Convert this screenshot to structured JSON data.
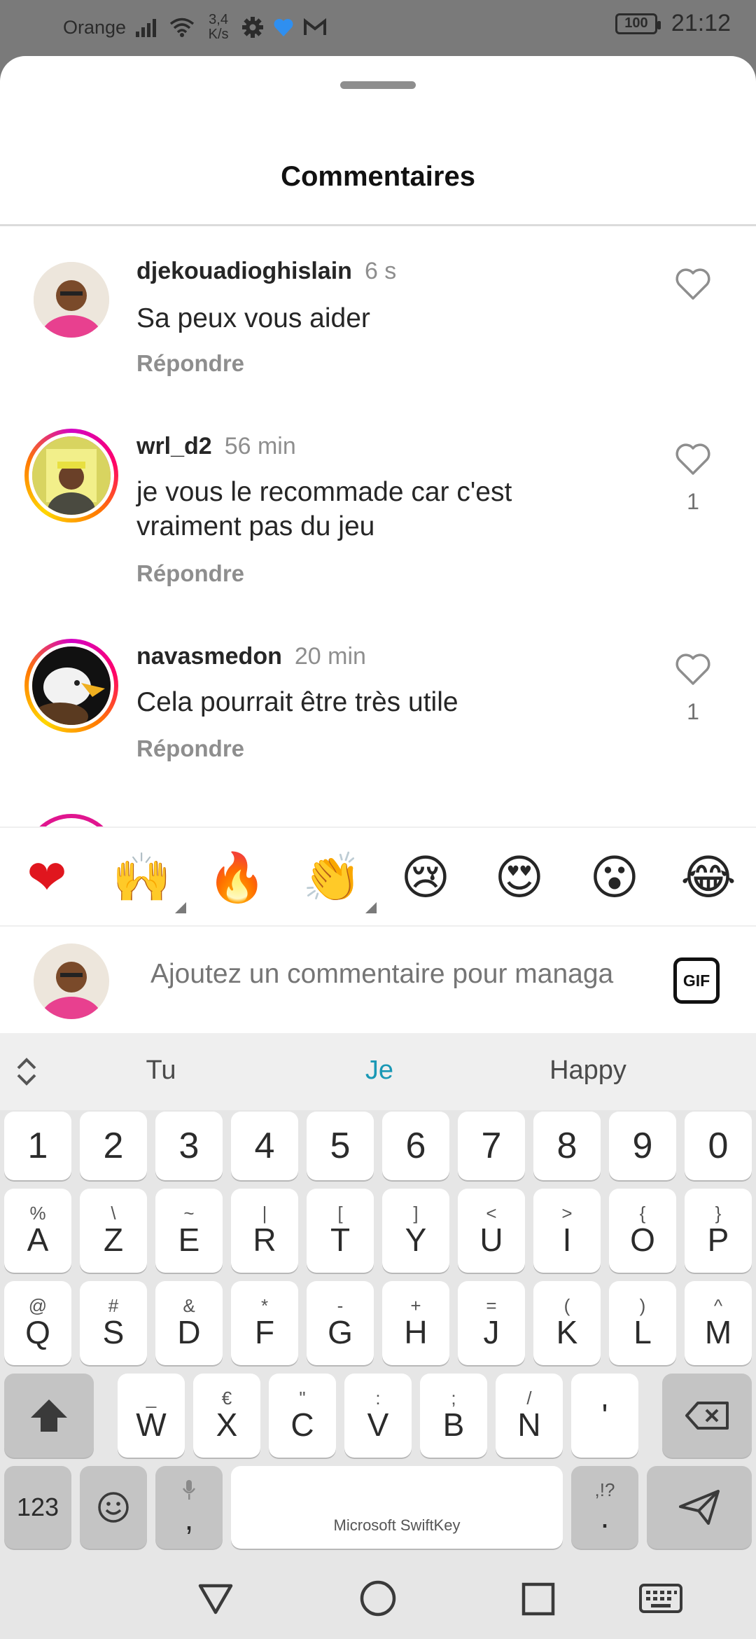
{
  "status_bar": {
    "carrier": "Orange",
    "speed_value": "3,4",
    "speed_unit": "K/s",
    "battery": "100",
    "time": "21:12"
  },
  "sheet": {
    "title": "Commentaires"
  },
  "comments": [
    {
      "user": "djekouadioghislain",
      "time": "6 s",
      "text": "Sa peux vous aider",
      "reply": "Répondre",
      "likes": ""
    },
    {
      "user": "wrl_d2",
      "time": "56 min",
      "text": "je vous le recommade car c'est vraiment pas du jeu",
      "reply": "Répondre",
      "likes": "1"
    },
    {
      "user": "navasmedon",
      "time": "20 min",
      "text": "Cela pourrait être très utile",
      "reply": "Répondre",
      "likes": "1"
    }
  ],
  "emoji_bar": {
    "items": [
      "❤",
      "🙌",
      "🔥",
      "👏",
      "😢",
      "😍",
      "😮",
      "😂"
    ]
  },
  "input": {
    "placeholder": "Ajoutez un commentaire pour managa",
    "gif_label": "GIF"
  },
  "keyboard": {
    "suggestions": [
      "Tu",
      "Je",
      "Happy"
    ],
    "row_numbers": [
      "1",
      "2",
      "3",
      "4",
      "5",
      "6",
      "7",
      "8",
      "9",
      "0"
    ],
    "row1": [
      [
        "%",
        "A"
      ],
      [
        "\\",
        "Z"
      ],
      [
        "~",
        "E"
      ],
      [
        "|",
        "R"
      ],
      [
        "[",
        "T"
      ],
      [
        "]",
        "Y"
      ],
      [
        "<",
        "U"
      ],
      [
        ">",
        "I"
      ],
      [
        "{",
        "O"
      ],
      [
        "}",
        "P"
      ]
    ],
    "row2": [
      [
        "@",
        "Q"
      ],
      [
        "#",
        "S"
      ],
      [
        "&",
        "D"
      ],
      [
        "*",
        "F"
      ],
      [
        "-",
        "G"
      ],
      [
        "+",
        "H"
      ],
      [
        "=",
        "J"
      ],
      [
        "(",
        "K"
      ],
      [
        ")",
        "L"
      ],
      [
        "^",
        "M"
      ]
    ],
    "row3": [
      [
        "_",
        "W"
      ],
      [
        "€",
        "X"
      ],
      [
        "\"",
        "C"
      ],
      [
        ":",
        "V"
      ],
      [
        ";",
        "B"
      ],
      [
        "/",
        "N"
      ],
      [
        "",
        "'"
      ]
    ],
    "key_123": "123",
    "comma": ",",
    "space_label": "Microsoft SwiftKey",
    "period_sub": ",!?",
    "period": "."
  }
}
